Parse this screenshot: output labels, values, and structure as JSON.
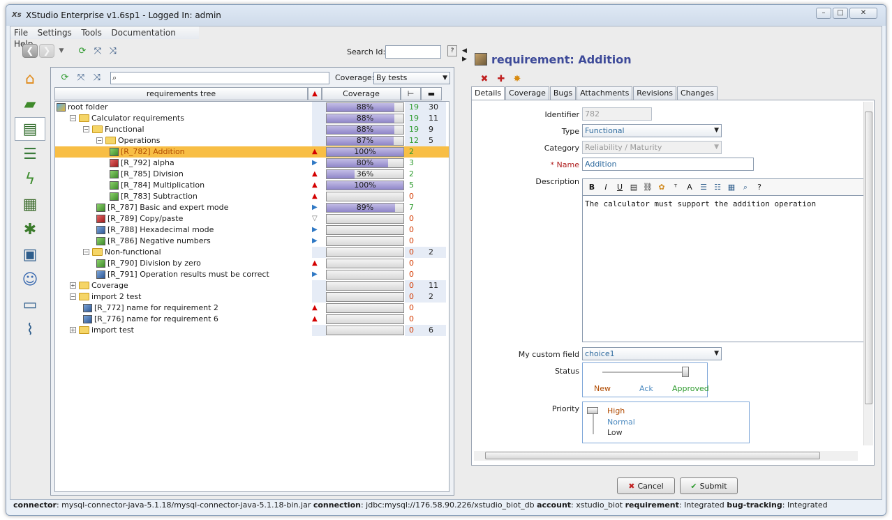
{
  "window": {
    "title": "XStudio Enterprise v1.6sp1 - Logged In: admin",
    "app_icon_text": "Xs"
  },
  "menu": [
    "File",
    "Settings",
    "Tools",
    "Documentation",
    "Help"
  ],
  "toolbar": {
    "search_label": "Search Id:",
    "search_value": ""
  },
  "sidebar": [
    "home-icon",
    "ruler-icon",
    "requirements-icon",
    "books-icon",
    "lightning-icon",
    "clapper-icon",
    "bug-icon",
    "layout-icon",
    "user-icon",
    "computer-icon",
    "paperclip-icon"
  ],
  "tree": {
    "filter_value": "",
    "coverage_label": "Coverage:",
    "coverage_value": "By tests",
    "col_tree": "requirements tree",
    "col_coverage": "Coverage",
    "rows": [
      {
        "name": "root folder",
        "kind": "root",
        "expander": "",
        "indent": 0,
        "prio": "",
        "cov": 88,
        "cov_text": "88%",
        "c1": "19",
        "c2": "30",
        "sel": false
      },
      {
        "name": "Calculator requirements",
        "kind": "folder",
        "expander": "−",
        "indent": 1,
        "prio": "",
        "cov": 88,
        "cov_text": "88%",
        "c1": "19",
        "c2": "11",
        "sel": false
      },
      {
        "name": "Functional",
        "kind": "folder",
        "expander": "−",
        "indent": 2,
        "prio": "",
        "cov": 88,
        "cov_text": "88%",
        "c1": "19",
        "c2": "9",
        "sel": false
      },
      {
        "name": "Operations",
        "kind": "folder",
        "expander": "−",
        "indent": 3,
        "prio": "",
        "cov": 87,
        "cov_text": "87%",
        "c1": "12",
        "c2": "5",
        "sel": false
      },
      {
        "name": "[R_782] Addition",
        "kind": "req-green",
        "expander": "",
        "indent": 4,
        "prio": "▲",
        "prio_color": "#d40000",
        "cov": 100,
        "cov_text": "100%",
        "c1": "2",
        "c2": "",
        "sel": true
      },
      {
        "name": "[R_792] alpha",
        "kind": "req-red",
        "expander": "",
        "indent": 4,
        "prio": "▶",
        "prio_color": "#2f78c4",
        "cov": 80,
        "cov_text": "80%",
        "c1": "3",
        "c2": "",
        "sel": false
      },
      {
        "name": "[R_785] Division",
        "kind": "req-green",
        "expander": "",
        "indent": 4,
        "prio": "▲",
        "prio_color": "#d40000",
        "cov": 36,
        "cov_text": "36%",
        "c1": "2",
        "c2": "",
        "sel": false
      },
      {
        "name": "[R_784] Multiplication",
        "kind": "req-green",
        "expander": "",
        "indent": 4,
        "prio": "▲",
        "prio_color": "#d40000",
        "cov": 100,
        "cov_text": "100%",
        "c1": "5",
        "c2": "",
        "sel": false
      },
      {
        "name": "[R_783] Subtraction",
        "kind": "req-green",
        "expander": "",
        "indent": 4,
        "prio": "▲",
        "prio_color": "#d40000",
        "cov": 0,
        "cov_text": "",
        "c1": "0",
        "c2": "",
        "sel": false
      },
      {
        "name": "[R_787] Basic and expert mode",
        "kind": "req-green",
        "expander": "",
        "indent": 3,
        "prio": "▶",
        "prio_color": "#2f78c4",
        "cov": 89,
        "cov_text": "89%",
        "c1": "7",
        "c2": "",
        "sel": false
      },
      {
        "name": "[R_789] Copy/paste",
        "kind": "req-red",
        "expander": "",
        "indent": 3,
        "prio": "▽",
        "prio_color": "#777777",
        "cov": 0,
        "cov_text": "",
        "c1": "0",
        "c2": "",
        "sel": false
      },
      {
        "name": "[R_788] Hexadecimal mode",
        "kind": "req-blue",
        "expander": "",
        "indent": 3,
        "prio": "▶",
        "prio_color": "#2f78c4",
        "cov": 0,
        "cov_text": "",
        "c1": "0",
        "c2": "",
        "sel": false
      },
      {
        "name": "[R_786] Negative numbers",
        "kind": "req-green",
        "expander": "",
        "indent": 3,
        "prio": "▶",
        "prio_color": "#2f78c4",
        "cov": 0,
        "cov_text": "",
        "c1": "0",
        "c2": "",
        "sel": false
      },
      {
        "name": "Non-functional",
        "kind": "folder",
        "expander": "−",
        "indent": 2,
        "prio": "",
        "cov": 0,
        "cov_text": "",
        "c1": "0",
        "c2": "2",
        "sel": false
      },
      {
        "name": "[R_790] Division by zero",
        "kind": "req-green",
        "expander": "",
        "indent": 3,
        "prio": "▲",
        "prio_color": "#d40000",
        "cov": 0,
        "cov_text": "",
        "c1": "0",
        "c2": "",
        "sel": false
      },
      {
        "name": "[R_791] Operation results must be correct",
        "kind": "req-blue",
        "expander": "",
        "indent": 3,
        "prio": "▶",
        "prio_color": "#2f78c4",
        "cov": 0,
        "cov_text": "",
        "c1": "0",
        "c2": "",
        "sel": false
      },
      {
        "name": "Coverage",
        "kind": "folder",
        "expander": "+",
        "indent": 1,
        "prio": "",
        "cov": 0,
        "cov_text": "",
        "c1": "0",
        "c2": "11",
        "sel": false
      },
      {
        "name": "import 2 test",
        "kind": "folder",
        "expander": "−",
        "indent": 1,
        "prio": "",
        "cov": 0,
        "cov_text": "",
        "c1": "0",
        "c2": "2",
        "sel": false
      },
      {
        "name": "[R_772] name for requirement 2",
        "kind": "req-blue",
        "expander": "",
        "indent": 2,
        "prio": "▲",
        "prio_color": "#d40000",
        "cov": 0,
        "cov_text": "",
        "c1": "0",
        "c2": "",
        "sel": false
      },
      {
        "name": "[R_776] name for requirement 6",
        "kind": "req-blue",
        "expander": "",
        "indent": 2,
        "prio": "▲",
        "prio_color": "#d40000",
        "cov": 0,
        "cov_text": "",
        "c1": "0",
        "c2": "",
        "sel": false
      },
      {
        "name": "import test",
        "kind": "folder",
        "expander": "+",
        "indent": 1,
        "prio": "",
        "cov": 0,
        "cov_text": "",
        "c1": "0",
        "c2": "6",
        "sel": false
      }
    ]
  },
  "detail": {
    "title": "requirement: Addition",
    "tabs": [
      "Details",
      "Coverage",
      "Bugs",
      "Attachments",
      "Revisions",
      "Changes"
    ],
    "identifier_label": "Identifier",
    "identifier_value": "782",
    "type_label": "Type",
    "type_value": "Functional",
    "category_label": "Category",
    "category_value": "Reliability / Maturity",
    "name_label": "* Name",
    "name_value": "Addition",
    "description_label": "Description",
    "description_value": "The calculator must support the addition operation",
    "custom_label": "My custom field",
    "custom_value": "choice1",
    "status_label": "Status",
    "status_new": "New",
    "status_ack": "Ack",
    "status_approved": "Approved",
    "priority_label": "Priority",
    "priority_high": "High",
    "priority_normal": "Normal",
    "priority_low": "Low",
    "cancel": "Cancel",
    "submit": "Submit"
  },
  "statusbar": {
    "connector_label": "connector",
    "connector_value": ": mysql-connector-java-5.1.18/mysql-connector-java-5.1.18-bin.jar ",
    "connection_label": "connection",
    "connection_value": ": jdbc:mysql://176.58.90.226/xstudio_biot_db ",
    "account_label": "account",
    "account_value": ": xstudio_biot ",
    "requirement_label": "requirement",
    "requirement_value": ": Integrated ",
    "bugtracking_label": "bug-tracking",
    "bugtracking_value": ": Integrated"
  },
  "colors": {
    "selected_row": "#f8be45",
    "coverage_fill": "#9f97d4",
    "count_green": "#2e9b2e",
    "count_red": "#d43a00",
    "title_blue": "#3d4a99"
  }
}
